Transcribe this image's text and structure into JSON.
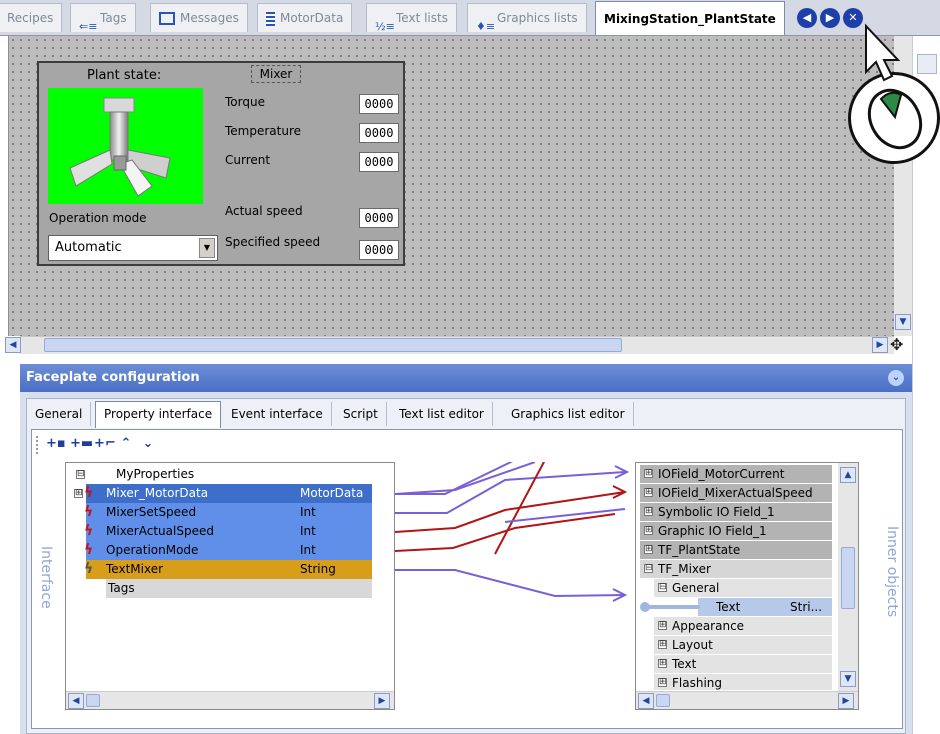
{
  "tabs": [
    {
      "label": "Recipes",
      "icon": "recipe-icon"
    },
    {
      "label": "Tags",
      "icon": "tags-icon"
    },
    {
      "label": "Messages",
      "icon": "messages-icon"
    },
    {
      "label": "MotorData",
      "icon": "motordata-icon"
    },
    {
      "label": "Text lists",
      "icon": "textlist-icon"
    },
    {
      "label": "Graphics lists",
      "icon": "graphicslist-icon"
    },
    {
      "label": "MixingStation_PlantState",
      "icon": ""
    }
  ],
  "nav": {
    "prev": "◀",
    "next": "▶",
    "close": "✕"
  },
  "faceplate": {
    "plant_state_label": "Plant state:",
    "mixer_title": "Mixer",
    "torque_label": "Torque",
    "torque_value": "0000",
    "temperature_label": "Temperature",
    "temperature_value": "0000",
    "current_label": "Current",
    "current_value": "0000",
    "actual_speed_label": "Actual speed",
    "actual_speed_value": "0000",
    "specified_speed_label": "Specified speed",
    "specified_speed_value": "0000",
    "operation_mode_label": "Operation mode",
    "operation_mode_value": "Automatic"
  },
  "config": {
    "title": "Faceplate configuration",
    "tabs": [
      "General",
      "Property interface",
      "Event interface",
      "Script",
      "Text list editor",
      "Graphics list editor"
    ],
    "active_tab": "Property interface",
    "left_side_label": "Interface",
    "right_side_label": "Inner objects",
    "interface_tree": [
      {
        "name": "MyProperties",
        "type": "",
        "level": 0,
        "highlight": "none",
        "expander": "⊟"
      },
      {
        "name": "Mixer_MotorData",
        "type": "MotorData",
        "level": 1,
        "highlight": "dark",
        "expander": "⊞"
      },
      {
        "name": "MixerSetSpeed",
        "type": "Int",
        "level": 1,
        "highlight": "blue",
        "expander": ""
      },
      {
        "name": "MixerActualSpeed",
        "type": "Int",
        "level": 1,
        "highlight": "blue",
        "expander": ""
      },
      {
        "name": "OperationMode",
        "type": "Int",
        "level": 1,
        "highlight": "blue",
        "expander": ""
      },
      {
        "name": "TextMixer",
        "type": "String",
        "level": 1,
        "highlight": "orange",
        "expander": ""
      },
      {
        "name": "Tags",
        "type": "",
        "level": 0,
        "highlight": "gray",
        "expander": ""
      }
    ],
    "inner_objects": [
      {
        "name": "IOField_MotorCurrent",
        "exp": "⊞",
        "indent": 0,
        "style": "gray"
      },
      {
        "name": "IOField_MixerActualSpeed",
        "exp": "⊞",
        "indent": 0,
        "style": "gray"
      },
      {
        "name": "Symbolic IO Field_1",
        "exp": "⊞",
        "indent": 0,
        "style": "gray"
      },
      {
        "name": "Graphic IO Field_1",
        "exp": "⊞",
        "indent": 0,
        "style": "gray"
      },
      {
        "name": "TF_PlantState",
        "exp": "⊞",
        "indent": 0,
        "style": "gray"
      },
      {
        "name": "TF_Mixer",
        "exp": "⊟",
        "indent": 0,
        "style": "gray"
      },
      {
        "name": "General",
        "exp": "⊟",
        "indent": 1,
        "style": "light"
      },
      {
        "name": "Text",
        "exp": "",
        "indent": 2,
        "style": "selected",
        "type": "Stri..."
      },
      {
        "name": "Appearance",
        "exp": "⊞",
        "indent": 1,
        "style": "light"
      },
      {
        "name": "Layout",
        "exp": "⊞",
        "indent": 1,
        "style": "light"
      },
      {
        "name": "Text",
        "exp": "⊞",
        "indent": 1,
        "style": "light"
      },
      {
        "name": "Flashing",
        "exp": "⊞",
        "indent": 1,
        "style": "light"
      }
    ],
    "toolbar_icons": [
      "add-property-icon",
      "add-property-group-icon",
      "add-property-item-icon",
      "move-up-icon",
      "move-down-icon"
    ]
  },
  "colors": {
    "link_purple": "#7a60d6",
    "link_red": "#b01616",
    "highlight_blue": "#5f8fe8",
    "highlight_dark": "#3d6ec9",
    "highlight_orange": "#d89e1a",
    "canvas_gray": "#bdbdbd",
    "mixer_green": "#00ff00"
  }
}
